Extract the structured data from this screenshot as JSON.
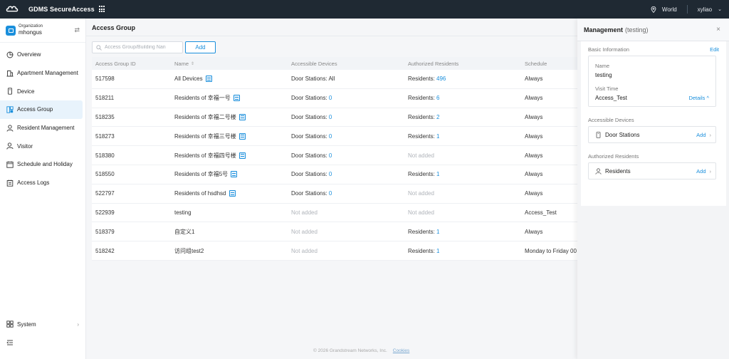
{
  "app": {
    "title": "GDMS SecureAccess"
  },
  "topbar": {
    "region": "World",
    "user": "xyliao"
  },
  "org": {
    "label": "Organization",
    "name": "mhongus"
  },
  "sidebar": {
    "items": [
      {
        "label": "Overview",
        "icon": "overview-icon"
      },
      {
        "label": "Apartment Management",
        "icon": "apartment-icon"
      },
      {
        "label": "Device",
        "icon": "device-icon"
      },
      {
        "label": "Access Group",
        "icon": "access-group-icon",
        "active": true
      },
      {
        "label": "Resident Management",
        "icon": "resident-icon"
      },
      {
        "label": "Visitor",
        "icon": "visitor-icon"
      },
      {
        "label": "Schedule and Holiday",
        "icon": "calendar-icon"
      },
      {
        "label": "Access Logs",
        "icon": "logs-icon"
      }
    ],
    "system_label": "System"
  },
  "main": {
    "title": "Access Group",
    "search_placeholder": "Access Group/Building Nan",
    "add_label": "Add",
    "columns": [
      "Access Group ID",
      "Name",
      "Accessible Devices",
      "Authorized Residents",
      "Schedule"
    ],
    "rows": [
      {
        "id": "517598",
        "name": "All Devices",
        "building": true,
        "devices_prefix": "Door Stations: All",
        "devices_count": "",
        "devices_none": false,
        "residents_prefix": "Residents: ",
        "residents_count": "496",
        "residents_none": false,
        "schedule": "Always"
      },
      {
        "id": "518211",
        "name": "Residents of 幸福一号",
        "building": true,
        "devices_prefix": "Door Stations: ",
        "devices_count": "0",
        "devices_none": false,
        "residents_prefix": "Residents: ",
        "residents_count": "6",
        "residents_none": false,
        "schedule": "Always"
      },
      {
        "id": "518235",
        "name": "Residents of 幸福二号楼",
        "building": true,
        "devices_prefix": "Door Stations: ",
        "devices_count": "0",
        "devices_none": false,
        "residents_prefix": "Residents: ",
        "residents_count": "2",
        "residents_none": false,
        "schedule": "Always"
      },
      {
        "id": "518273",
        "name": "Residents of 幸福三号楼",
        "building": true,
        "devices_prefix": "Door Stations: ",
        "devices_count": "0",
        "devices_none": false,
        "residents_prefix": "Residents: ",
        "residents_count": "1",
        "residents_none": false,
        "schedule": "Always"
      },
      {
        "id": "518380",
        "name": "Residents of 幸福四号楼",
        "building": true,
        "devices_prefix": "Door Stations: ",
        "devices_count": "0",
        "devices_none": false,
        "residents_prefix": "Not added",
        "residents_count": "",
        "residents_none": true,
        "schedule": "Always"
      },
      {
        "id": "518550",
        "name": "Residents of 幸福5号",
        "building": true,
        "devices_prefix": "Door Stations: ",
        "devices_count": "0",
        "devices_none": false,
        "residents_prefix": "Residents: ",
        "residents_count": "1",
        "residents_none": false,
        "schedule": "Always"
      },
      {
        "id": "522797",
        "name": "Residents of hsdhsd",
        "building": true,
        "devices_prefix": "Door Stations: ",
        "devices_count": "0",
        "devices_none": false,
        "residents_prefix": "Not added",
        "residents_count": "",
        "residents_none": true,
        "schedule": "Always"
      },
      {
        "id": "522939",
        "name": "testing",
        "building": false,
        "devices_prefix": "Not added",
        "devices_count": "",
        "devices_none": true,
        "residents_prefix": "Not added",
        "residents_count": "",
        "residents_none": true,
        "schedule": "Access_Test"
      },
      {
        "id": "518379",
        "name": "自定义1",
        "building": false,
        "devices_prefix": "Not added",
        "devices_count": "",
        "devices_none": true,
        "residents_prefix": "Residents: ",
        "residents_count": "1",
        "residents_none": false,
        "schedule": "Always"
      },
      {
        "id": "518242",
        "name": "访问组test2",
        "building": false,
        "devices_prefix": "Not added",
        "devices_count": "",
        "devices_none": true,
        "residents_prefix": "Residents: ",
        "residents_count": "1",
        "residents_none": false,
        "schedule": "Monday to Friday 00"
      }
    ]
  },
  "footer": {
    "copyright": "© 2026 Grandstream Networks, Inc.",
    "cookies": "Cookies"
  },
  "panel": {
    "title": "Management",
    "subtitle": "(testing)",
    "basic_label": "Basic Information",
    "edit_label": "Edit",
    "name_label": "Name",
    "name_value": "testing",
    "visit_label": "Visit Time",
    "visit_value": "Access_Test",
    "details_label": "Details ^",
    "devices_label": "Accessible Devices",
    "door_label": "Door Stations",
    "residents_label": "Authorized Residents",
    "residents_entry": "Residents",
    "add_label": "Add"
  },
  "colors": {
    "accent": "#1a8fdc",
    "topbar": "#1f2933"
  }
}
